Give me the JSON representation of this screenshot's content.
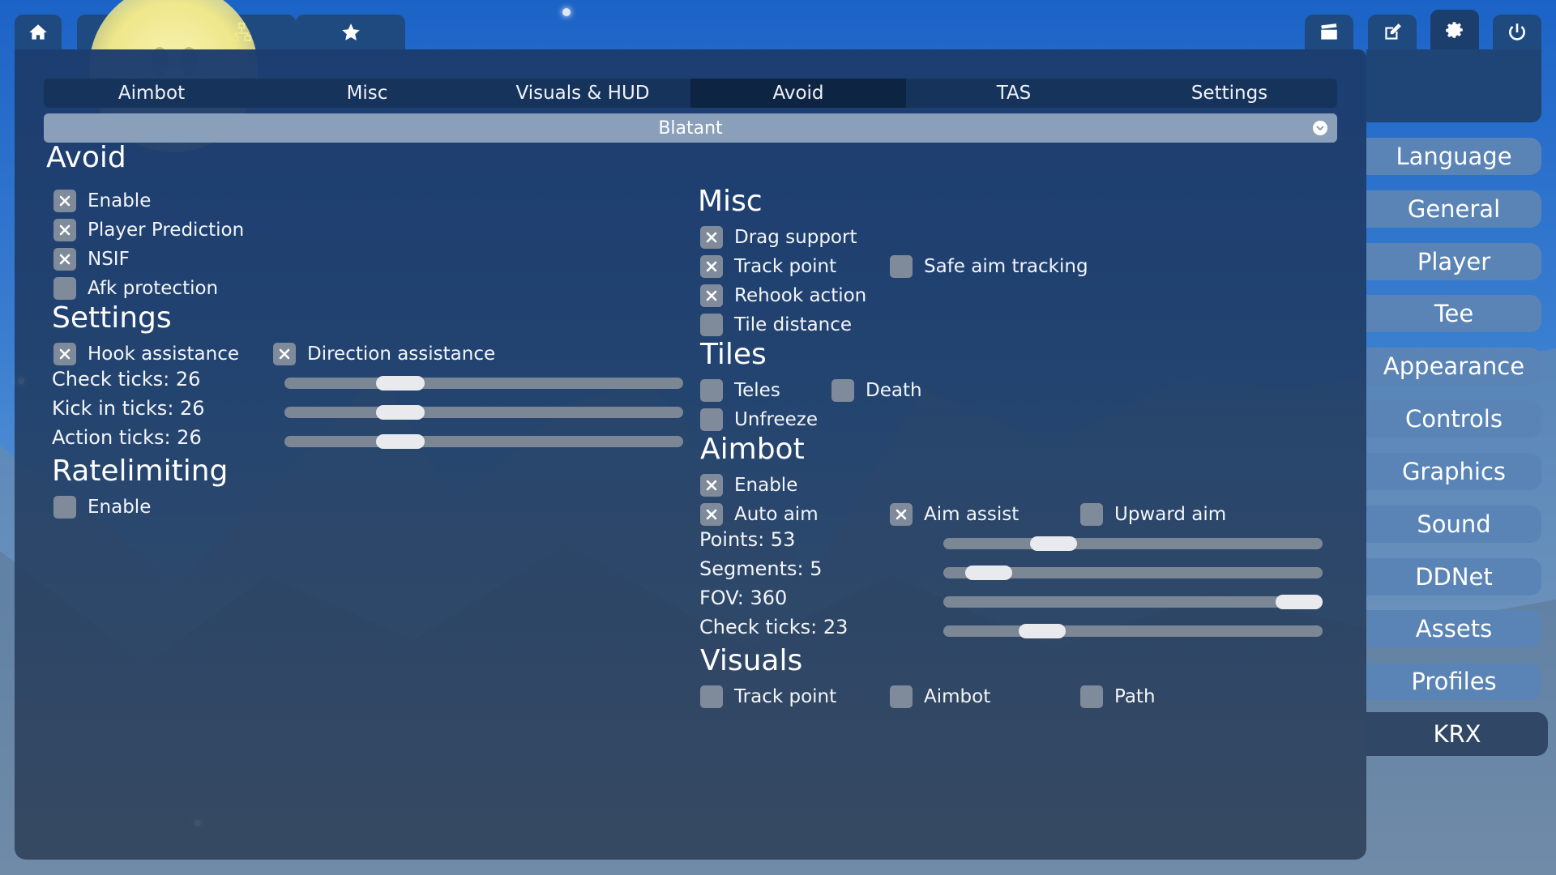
{
  "top_tabs": [
    {
      "icon": "home-icon"
    },
    {
      "icon": "globe-icon"
    },
    {
      "icon": "network-icon"
    },
    {
      "icon": "star-icon"
    },
    {
      "icon": "clapperboard-icon"
    },
    {
      "icon": "edit-icon"
    },
    {
      "icon": "gear-icon"
    },
    {
      "icon": "power-icon"
    }
  ],
  "sub_tabs": [
    "Aimbot",
    "Misc",
    "Visuals & HUD",
    "Avoid",
    "TAS",
    "Settings"
  ],
  "active_sub_tab": "Avoid",
  "dropdown": {
    "value": "Blatant"
  },
  "left": {
    "avoid": {
      "title": "Avoid",
      "items": [
        {
          "label": "Enable",
          "checked": true
        },
        {
          "label": "Player Prediction",
          "checked": true
        },
        {
          "label": "NSIF",
          "checked": true
        },
        {
          "label": "Afk protection",
          "checked": false
        }
      ]
    },
    "settings": {
      "title": "Settings",
      "hook": {
        "label": "Hook assistance",
        "checked": true
      },
      "direction": {
        "label": "Direction assistance",
        "checked": true
      },
      "sliders": [
        {
          "label": "Check ticks: 26",
          "fraction": 0.29
        },
        {
          "label": "Kick in ticks: 26",
          "fraction": 0.29
        },
        {
          "label": "Action ticks: 26",
          "fraction": 0.29
        }
      ]
    },
    "ratelimiting": {
      "title": "Ratelimiting",
      "enable": {
        "label": "Enable",
        "checked": false
      }
    }
  },
  "right": {
    "misc": {
      "title": "Misc",
      "drag": {
        "label": "Drag support",
        "checked": true
      },
      "track": {
        "label": "Track point",
        "checked": true
      },
      "safe": {
        "label": "Safe aim tracking",
        "checked": false
      },
      "rehook": {
        "label": "Rehook action",
        "checked": true
      },
      "tile": {
        "label": "Tile distance",
        "checked": false
      }
    },
    "tiles": {
      "title": "Tiles",
      "teles": {
        "label": "Teles",
        "checked": false
      },
      "death": {
        "label": "Death",
        "checked": false
      },
      "unfreeze": {
        "label": "Unfreeze",
        "checked": false
      }
    },
    "aimbot": {
      "title": "Aimbot",
      "enable": {
        "label": "Enable",
        "checked": true
      },
      "auto": {
        "label": "Auto aim",
        "checked": true
      },
      "assist": {
        "label": "Aim assist",
        "checked": true
      },
      "upward": {
        "label": "Upward aim",
        "checked": false
      },
      "sliders": [
        {
          "label": "Points: 53",
          "fraction": 0.29
        },
        {
          "label": "Segments: 5",
          "fraction": 0.12
        },
        {
          "label": "FOV: 360",
          "fraction": 0.94
        },
        {
          "label": "Check ticks: 23",
          "fraction": 0.26
        }
      ]
    },
    "visuals": {
      "title": "Visuals",
      "track": {
        "label": "Track point",
        "checked": false
      },
      "aimbot": {
        "label": "Aimbot",
        "checked": false
      },
      "path": {
        "label": "Path",
        "checked": false
      }
    }
  },
  "side_menu": [
    "Language",
    "General",
    "Player",
    "Tee",
    "Appearance",
    "Controls",
    "Graphics",
    "Sound",
    "DDNet",
    "Assets",
    "Profiles",
    "KRX"
  ],
  "active_side_menu": "KRX",
  "colors": {
    "panel": "#1f4577",
    "checkbox": "#7f8a9a",
    "menu": "#5a84b6",
    "menu_active": "#304766"
  }
}
